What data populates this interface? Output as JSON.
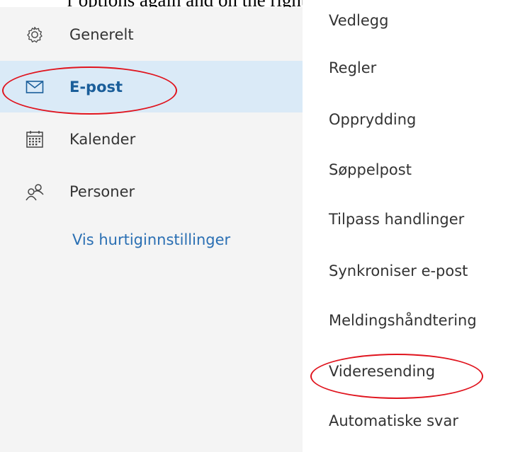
{
  "header_text": "r options again and on the right you see",
  "nav": {
    "items": [
      {
        "label": "Generelt",
        "icon": "gear-icon"
      },
      {
        "label": "E-post",
        "icon": "mail-icon"
      },
      {
        "label": "Kalender",
        "icon": "calendar-icon"
      },
      {
        "label": "Personer",
        "icon": "people-icon"
      }
    ],
    "selected": "E-post",
    "quick_settings_link": "Vis hurtiginnstillinger"
  },
  "mail_menu": {
    "items": [
      "Vedlegg",
      "Regler",
      "Opprydding",
      "Søppelpost",
      "Tilpass handlinger",
      "Synkroniser e-post",
      "Meldingshåndtering",
      "Videresending",
      "Automatiske svar"
    ]
  },
  "colors": {
    "nav_background": "#f4f4f4",
    "selected_background": "#daeaf7",
    "selected_text": "#1a5e9a",
    "link": "#2a6fb3",
    "annotation": "#e0141e"
  },
  "annotations": [
    "E-post",
    "Videresending"
  ]
}
